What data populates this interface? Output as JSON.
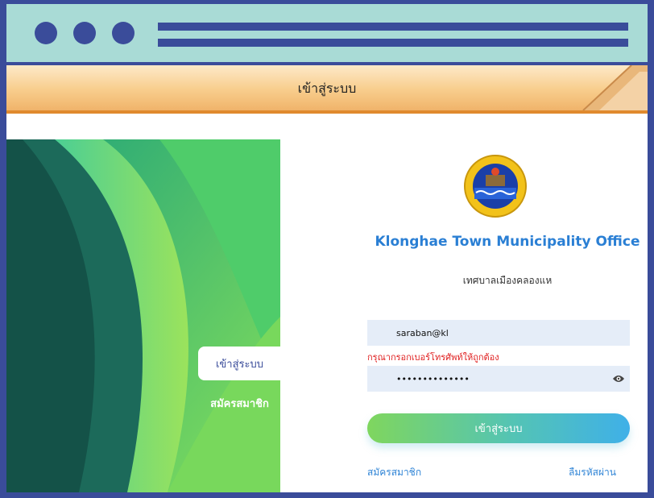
{
  "header": {
    "title": "เข้าสู่ระบบ"
  },
  "side_tabs": {
    "login": "เข้าสู่ระบบ",
    "register": "สมัครสมาชิก"
  },
  "org": {
    "title": "Klonghae Town Municipality Office",
    "subtitle": "เทศบาลเมืองคลองแห"
  },
  "form": {
    "username_value": "saraban@kl",
    "error_text": "กรุณากรอกเบอร์โทรศัพท์ให้ถูกต้อง",
    "password_value": "••••••••••••••",
    "login_button": "เข้าสู่ระบบ",
    "register_link": "สมัครสมาชิก",
    "forgot_link": "ลืมรหัสผ่าน"
  },
  "colors": {
    "frame": "#3a4c9a",
    "titlebar": "#a9dbd6",
    "accent_blue": "#2a7fd4",
    "error": "#e02020"
  }
}
